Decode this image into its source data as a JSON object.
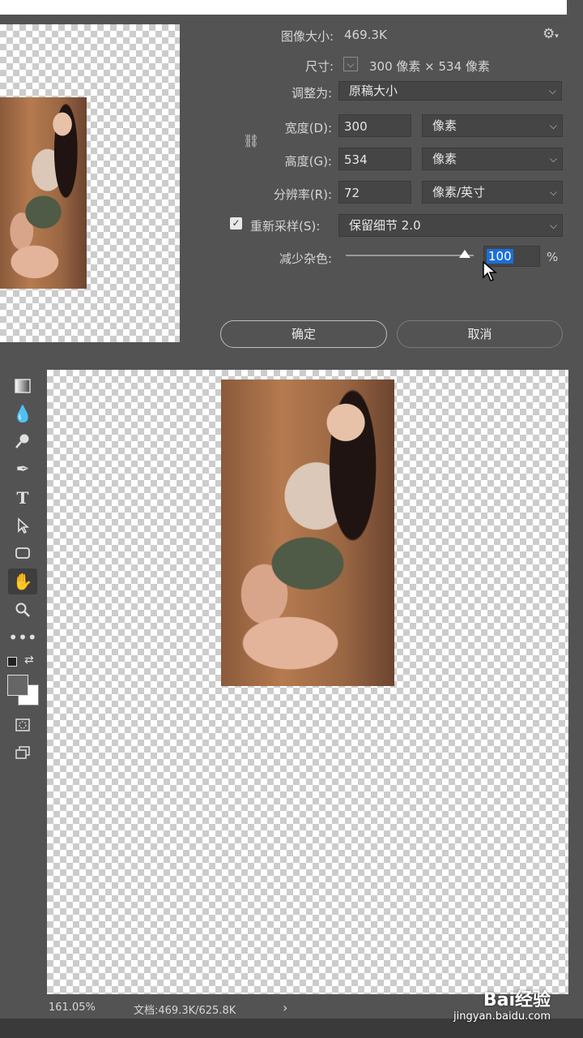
{
  "dialog": {
    "image_size_label": "图像大小:",
    "image_size_value": "469.3K",
    "dimensions_label": "尺寸:",
    "dimensions_value": "300 像素 × 534 像素",
    "fit_to_label": "调整为:",
    "fit_to_value": "原稿大小",
    "width_label": "宽度(D):",
    "width_value": "300",
    "width_unit": "像素",
    "height_label": "高度(G):",
    "height_value": "534",
    "height_unit": "像素",
    "resolution_label": "分辨率(R):",
    "resolution_value": "72",
    "resolution_unit": "像素/英寸",
    "resample_label": "重新采样(S):",
    "resample_checked": true,
    "resample_value": "保留细节 2.0",
    "noise_label": "减少杂色:",
    "noise_value": "100",
    "noise_unit": "%",
    "noise_level": 0.93,
    "ok_label": "确定",
    "cancel_label": "取消"
  },
  "toolbar": {
    "tools": [
      "gradient-tool",
      "blur-tool",
      "dodge-tool",
      "pen-tool",
      "type-tool",
      "path-selection-tool",
      "rectangle-tool",
      "hand-tool",
      "zoom-tool",
      "more-tools"
    ],
    "active_tool": "hand-tool"
  },
  "colors": {
    "foreground": "#666666",
    "background": "#ffffff",
    "selection": "#1c6fd6",
    "panel": "#535353"
  },
  "status": {
    "zoom": "161.05%",
    "doc_info": "文档:469.3K/625.8K",
    "arrow": "›"
  },
  "watermark": {
    "logo_text": "Bai经验",
    "url": "jingyan.baidu.com"
  }
}
